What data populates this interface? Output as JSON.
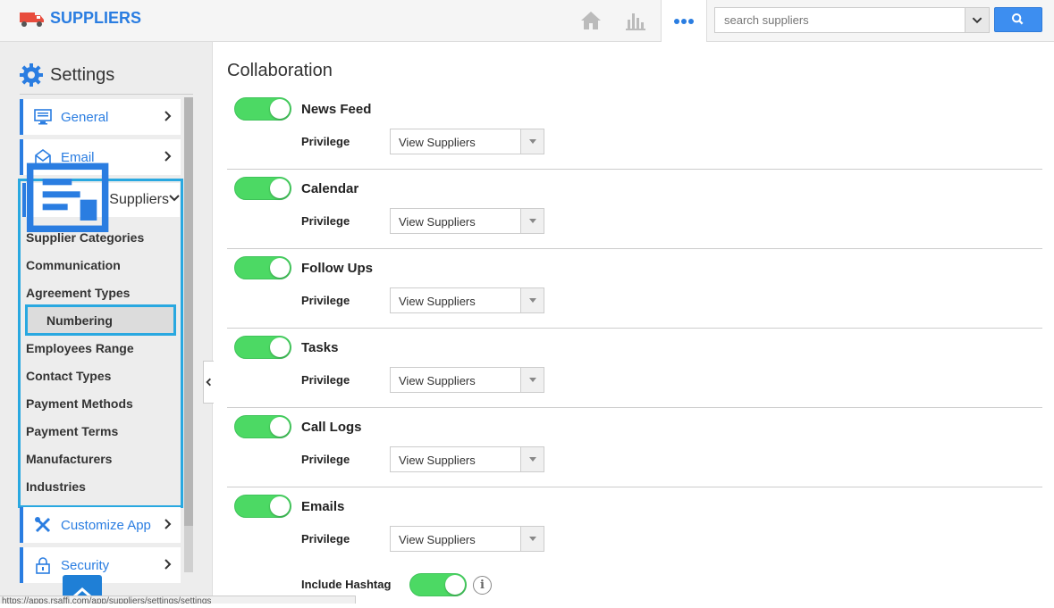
{
  "app": {
    "title": "SUPPLIERS"
  },
  "search": {
    "placeholder": "search suppliers"
  },
  "sidebar": {
    "title": "Settings",
    "items": [
      {
        "label": "General",
        "icon": "monitor-icon"
      },
      {
        "label": "Email",
        "icon": "envelope-icon"
      },
      {
        "label": "Suppliers",
        "icon": "suppliers-icon"
      },
      {
        "label": "Customize App",
        "icon": "tools-icon"
      },
      {
        "label": "Security",
        "icon": "lock-icon"
      }
    ],
    "sub_items": [
      "Supplier Categories",
      "Communication",
      "Agreement Types",
      "Numbering",
      "Employees Range",
      "Contact Types",
      "Payment Methods",
      "Payment Terms",
      "Manufacturers",
      "Industries"
    ],
    "selected_sub_item": "Numbering"
  },
  "status_url": "https://apps.rsaffi.com/app/suppliers/settings/settings",
  "main": {
    "title": "Collaboration",
    "privilege_label": "Privilege",
    "features": [
      {
        "label": "News Feed",
        "enabled": true,
        "privilege": "View Suppliers"
      },
      {
        "label": "Calendar",
        "enabled": true,
        "privilege": "View Suppliers"
      },
      {
        "label": "Follow Ups",
        "enabled": true,
        "privilege": "View Suppliers"
      },
      {
        "label": "Tasks",
        "enabled": true,
        "privilege": "View Suppliers"
      },
      {
        "label": "Call Logs",
        "enabled": true,
        "privilege": "View Suppliers"
      },
      {
        "label": "Emails",
        "enabled": true,
        "privilege": "View Suppliers"
      }
    ],
    "include_hashtag": {
      "label": "Include Hashtag",
      "enabled": true,
      "info": "i"
    }
  },
  "colors": {
    "accent": "#2a7de1",
    "toggle_on": "#4cd964",
    "highlight": "#29a8e0"
  }
}
